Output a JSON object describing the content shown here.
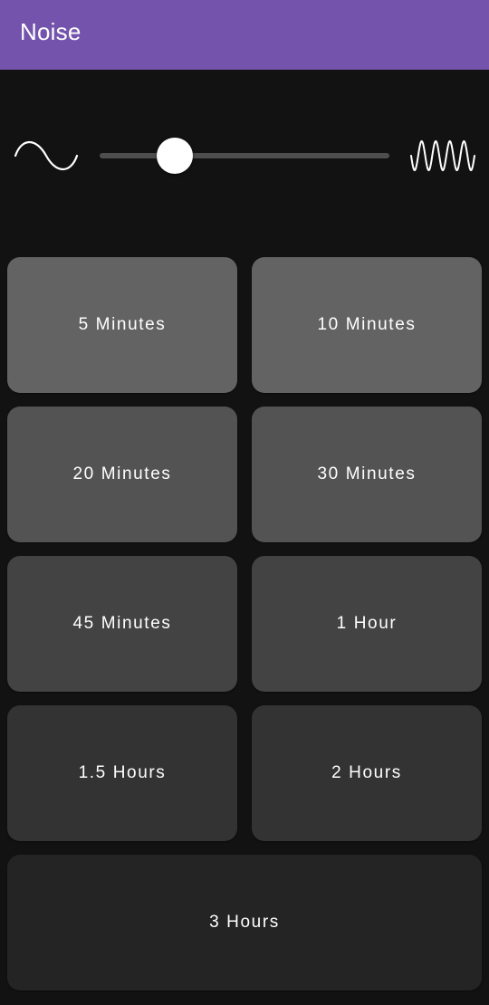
{
  "app_bar": {
    "title": "Noise",
    "color": "#7353ac"
  },
  "frequency_slider": {
    "low_icon": "sine-wave-low-frequency-icon",
    "high_icon": "sine-wave-high-frequency-icon",
    "value_fraction": 0.26
  },
  "timer_buttons": [
    {
      "label": "5 Minutes",
      "color": "#636363"
    },
    {
      "label": "10 Minutes",
      "color": "#636363"
    },
    {
      "label": "20 Minutes",
      "color": "#535353"
    },
    {
      "label": "30 Minutes",
      "color": "#535353"
    },
    {
      "label": "45 Minutes",
      "color": "#434343"
    },
    {
      "label": "1 Hour",
      "color": "#434343"
    },
    {
      "label": "1.5 Hours",
      "color": "#333333"
    },
    {
      "label": "2 Hours",
      "color": "#333333"
    },
    {
      "label": "3 Hours",
      "color": "#242424"
    }
  ]
}
